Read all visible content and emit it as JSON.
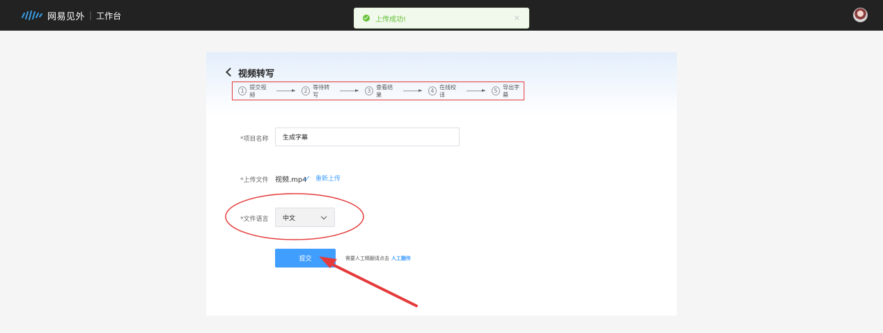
{
  "header": {
    "brand": "网易见外",
    "separator": "|",
    "section": "工作台",
    "logo_icon": "waveform-logo-icon",
    "avatar_icon": "user-avatar-icon"
  },
  "toast": {
    "message": "上传成功!",
    "close": "×",
    "icon": "success-check-icon",
    "color": "#67c23a"
  },
  "page": {
    "title": "视频转写",
    "back_icon": "chevron-left-icon"
  },
  "steps": [
    {
      "num": "1",
      "label": "提交视频"
    },
    {
      "num": "2",
      "label": "等待转写"
    },
    {
      "num": "3",
      "label": "查看结果"
    },
    {
      "num": "4",
      "label": "在线校译"
    },
    {
      "num": "5",
      "label": "导出字幕"
    }
  ],
  "form": {
    "project_label": "*项目名称",
    "project_value": "生成字幕",
    "upload_label": "*上传文件",
    "file_name": "视频.mp4",
    "reupload": "重新上传",
    "language_label": "*文件语言",
    "language_value": "中文",
    "submit": "提交",
    "hint": "需要人工精翻请点击",
    "hint_link": "人工翻传"
  },
  "colors": {
    "accent": "#409eff",
    "topbar": "#222222",
    "annotation": "#e53a3a"
  }
}
